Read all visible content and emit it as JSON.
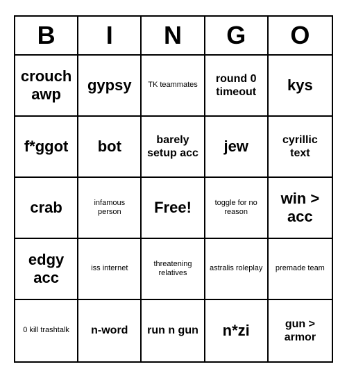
{
  "header": {
    "letters": [
      "B",
      "I",
      "N",
      "G",
      "O"
    ]
  },
  "cells": [
    {
      "text": "crouch awp",
      "size": "large"
    },
    {
      "text": "gypsy",
      "size": "large"
    },
    {
      "text": "TK teammates",
      "size": "small"
    },
    {
      "text": "round 0 timeout",
      "size": "medium"
    },
    {
      "text": "kys",
      "size": "large"
    },
    {
      "text": "f*ggot",
      "size": "large"
    },
    {
      "text": "bot",
      "size": "large"
    },
    {
      "text": "barely setup acc",
      "size": "medium"
    },
    {
      "text": "jew",
      "size": "large"
    },
    {
      "text": "cyrillic text",
      "size": "medium"
    },
    {
      "text": "crab",
      "size": "large"
    },
    {
      "text": "infamous person",
      "size": "small"
    },
    {
      "text": "Free!",
      "size": "free"
    },
    {
      "text": "toggle for no reason",
      "size": "small"
    },
    {
      "text": "win > acc",
      "size": "large"
    },
    {
      "text": "edgy acc",
      "size": "large"
    },
    {
      "text": "iss internet",
      "size": "small"
    },
    {
      "text": "threatening relatives",
      "size": "small"
    },
    {
      "text": "astralis roleplay",
      "size": "small"
    },
    {
      "text": "premade team",
      "size": "small"
    },
    {
      "text": "0 kill trashtalk",
      "size": "small"
    },
    {
      "text": "n-word",
      "size": "medium"
    },
    {
      "text": "run n gun",
      "size": "medium"
    },
    {
      "text": "n*zi",
      "size": "large"
    },
    {
      "text": "gun > armor",
      "size": "medium"
    }
  ]
}
